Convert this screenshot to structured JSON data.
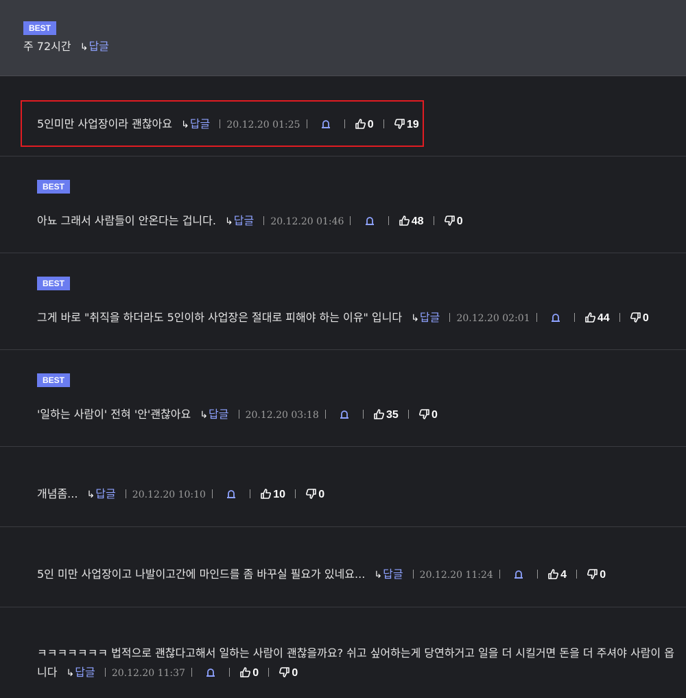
{
  "parent": {
    "badge": "BEST",
    "text": "주 72시간",
    "reply_label": "답글"
  },
  "comments": [
    {
      "text": "5인미만 사업장이라 괜찮아요",
      "reply_label": "답글",
      "date": "20.12.20 01:25",
      "likes": "0",
      "dislikes": "19"
    },
    {
      "badge": "BEST",
      "text": "아뇨 그래서 사람들이 안온다는 겁니다.",
      "reply_label": "답글",
      "date": "20.12.20 01:46",
      "likes": "48",
      "dislikes": "0"
    },
    {
      "badge": "BEST",
      "text": "그게 바로 \"취직을 하더라도 5인이하 사업장은 절대로 피해야 하는 이유\" 입니다",
      "reply_label": "답글",
      "date": "20.12.20 02:01",
      "likes": "44",
      "dislikes": "0"
    },
    {
      "badge": "BEST",
      "text": "'일하는 사람이' 전혀 '안'괜찮아요",
      "reply_label": "답글",
      "date": "20.12.20 03:18",
      "likes": "35",
      "dislikes": "0"
    },
    {
      "text": "개념좀...",
      "reply_label": "답글",
      "date": "20.12.20 10:10",
      "likes": "10",
      "dislikes": "0"
    },
    {
      "text": "5인 미만 사업장이고 나발이고간에 마인드를 좀 바꾸실 필요가 있네요...",
      "reply_label": "답글",
      "date": "20.12.20 11:24",
      "likes": "4",
      "dislikes": "0"
    },
    {
      "text": "ㅋㅋㅋㅋㅋㅋㅋ 법적으로 괜찮다고해서 일하는 사람이 괜찮을까요? 쉬고 싶어하는게 당연하거고 일을 더 시킬거면 돈을 더 주셔야 사람이 옵니다",
      "reply_label": "답글",
      "date": "20.12.20 11:37",
      "likes": "0",
      "dislikes": "0"
    }
  ],
  "colors": {
    "background": "#1e1f23",
    "parent_background": "#393b41",
    "badge": "#6a7cf0",
    "reply_link": "#8ea2ff",
    "highlight_border": "#e11c22"
  },
  "icons": {
    "reply": "reply-arrow-icon",
    "alarm": "siren-report-icon",
    "like": "thumbs-up-icon",
    "dislike": "thumbs-down-icon"
  }
}
